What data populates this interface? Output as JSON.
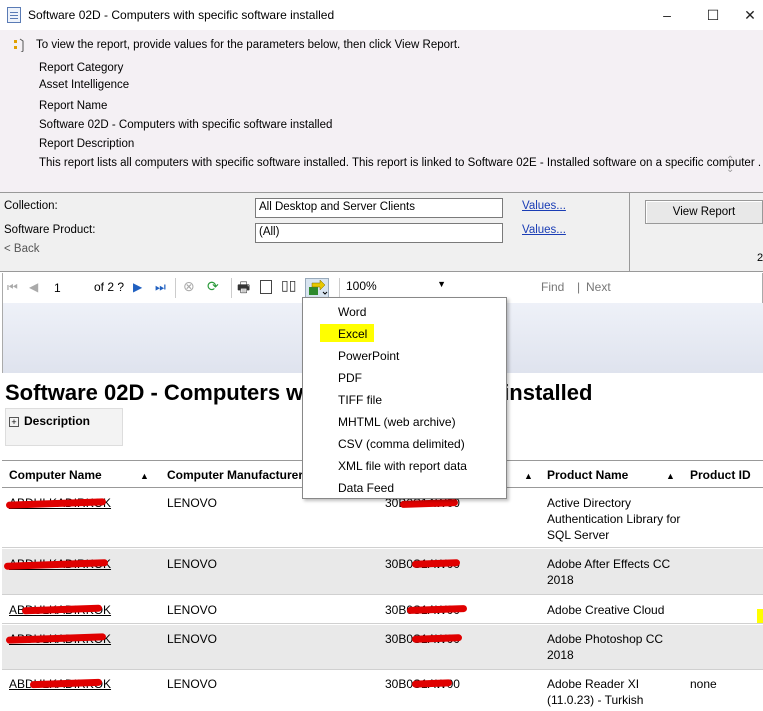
{
  "window": {
    "title": "Software 02D - Computers with specific software installed",
    "minimize": "–",
    "maximize": "☐",
    "close": "✕"
  },
  "header": {
    "instruction": "To view the report, provide values for the parameters below, then click View Report.",
    "category_label": "Report Category",
    "category_value": "Asset Intelligence",
    "name_label": "Report Name",
    "name_value": "Software 02D - Computers with specific software installed",
    "description_label": "Report Description",
    "description_value": "This report lists all computers with specific software installed. This report is linked to Software 02E - Installed software on a specific computer ."
  },
  "parameters": {
    "collection_label": "Collection:",
    "collection_value": "All Desktop and Server Clients",
    "collection_link": "Values...",
    "product_label": "Software Product:",
    "product_value": "(All)",
    "product_link": "Values...",
    "back_label": "< Back",
    "view_report": "View Report",
    "corner_digit": "2"
  },
  "toolbar": {
    "page": "1",
    "of_pages": "of  2 ?",
    "zoom": "100%",
    "find": "Find",
    "sep": "|",
    "next": "Next"
  },
  "export_menu": {
    "items": [
      "Word",
      "Excel",
      "PowerPoint",
      "PDF",
      "TIFF file",
      "MHTML (web archive)",
      "CSV (comma delimited)",
      "XML file with report data",
      "Data Feed"
    ],
    "highlighted": "Excel",
    "highlight_color": "#ffff00"
  },
  "report": {
    "title_left": "Software 02D - Computers w",
    "title_right": "re installed",
    "description_toggle": "Description",
    "columns": {
      "computer_name": "Computer Name",
      "manufacturer": "Computer Manufacturer",
      "product_name": "Product Name",
      "product_id": "Product ID"
    },
    "rows": [
      {
        "name": "ABDULKADIRKOK",
        "manufacturer": "LENOVO",
        "serial": "30B0S1AW00",
        "product": "Active Directory Authentication Library for SQL Server",
        "product_id": ""
      },
      {
        "name": "ABDULKADIRKOK",
        "manufacturer": "LENOVO",
        "serial": "30B0S1AW00",
        "product": "Adobe After Effects CC 2018",
        "product_id": ""
      },
      {
        "name": "ABDULKADIRKOK",
        "manufacturer": "LENOVO",
        "serial": "30B0S1AW00",
        "product": "Adobe Creative Cloud",
        "product_id": ""
      },
      {
        "name": "ABDULKADIRKOK",
        "manufacturer": "LENOVO",
        "serial": "30B0S1AW00",
        "product": "Adobe Photoshop CC 2018",
        "product_id": ""
      },
      {
        "name": "ABDULKADIRKOK",
        "manufacturer": "LENOVO",
        "serial": "30B0S1AW00",
        "product": "Adobe Reader XI (11.0.23) - Turkish",
        "product_id": "none"
      }
    ]
  },
  "colors": {
    "redaction": "#e00000",
    "link": "#1a3db5",
    "header_bg": "#f4f0f4"
  }
}
